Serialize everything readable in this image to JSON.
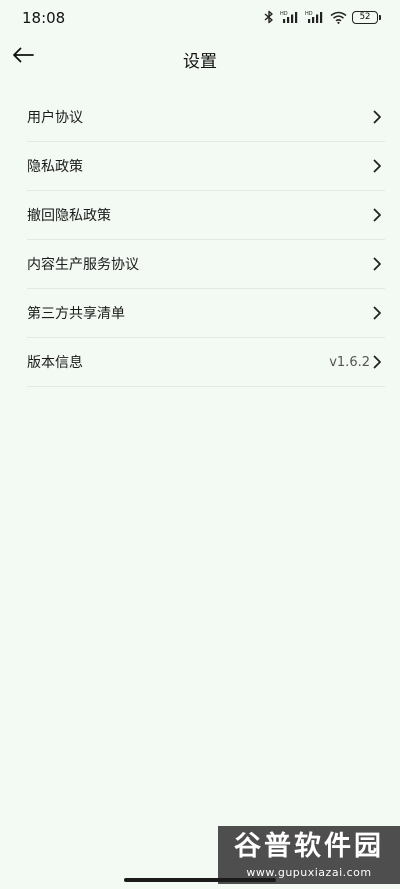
{
  "status_bar": {
    "time": "18:08",
    "battery": "52",
    "icons": [
      "bluetooth-icon",
      "hd-signal-icon",
      "hd-signal-icon",
      "wifi-icon",
      "battery-icon"
    ]
  },
  "header": {
    "title": "设置",
    "back_icon": "arrow-left-icon"
  },
  "menu": {
    "items": [
      {
        "label": "用户协议",
        "value": ""
      },
      {
        "label": "隐私政策",
        "value": ""
      },
      {
        "label": "撤回隐私政策",
        "value": ""
      },
      {
        "label": "内容生产服务协议",
        "value": ""
      },
      {
        "label": "第三方共享清单",
        "value": ""
      },
      {
        "label": "版本信息",
        "value": "v1.6.2"
      }
    ]
  },
  "watermark": {
    "title": "谷普软件园",
    "url": "www.gupuxiazai.com"
  },
  "colors": {
    "background": "#f3f9f3",
    "divider": "#e3e8e3",
    "text": "#1c1c1c",
    "watermark_bg": "#4e4e4e"
  }
}
